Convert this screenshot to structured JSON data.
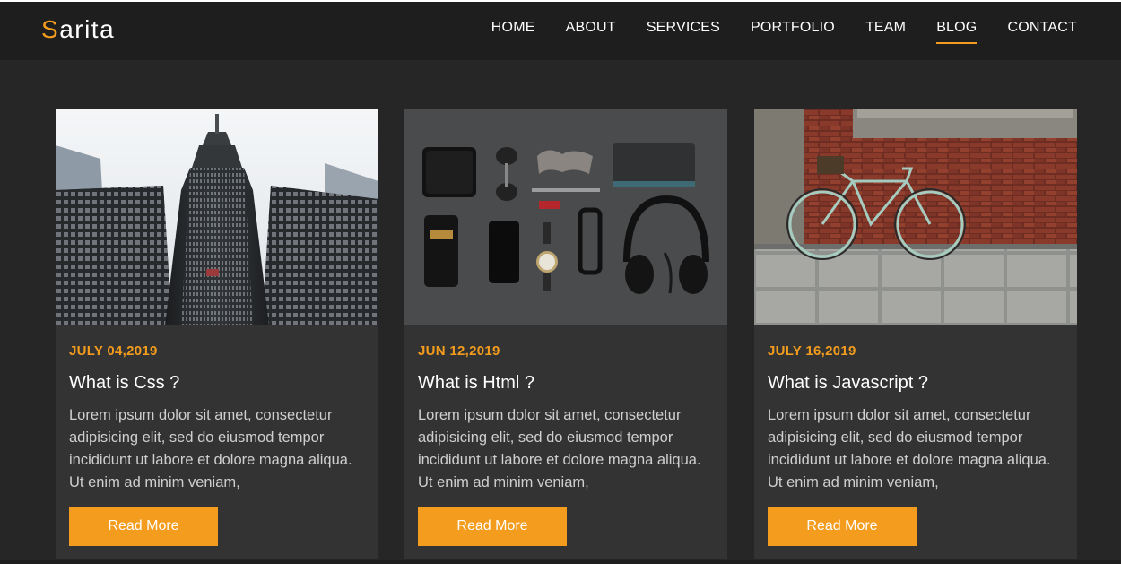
{
  "brand": {
    "first_letter": "S",
    "rest": "arita"
  },
  "nav": {
    "items": [
      {
        "label": "HOME"
      },
      {
        "label": "ABOUT"
      },
      {
        "label": "SERVICES"
      },
      {
        "label": "PORTFOLIO"
      },
      {
        "label": "TEAM"
      },
      {
        "label": "BLOG"
      },
      {
        "label": "CONTACT"
      }
    ],
    "active": "BLOG"
  },
  "posts": [
    {
      "date": "JULY 04,2019",
      "title": "What is Css ?",
      "excerpt": "Lorem ipsum dolor sit amet, consectetur adipisicing elit, sed do eiusmod tempor incididunt ut labore et dolore magna aliqua. Ut enim ad minim veniam,",
      "button": "Read More",
      "image": "skyscraper-photo"
    },
    {
      "date": "JUN 12,2019",
      "title": "What is Html ?",
      "excerpt": "Lorem ipsum dolor sit amet, consectetur adipisicing elit, sed do eiusmod tempor incididunt ut labore et dolore magna aliqua. Ut enim ad minim veniam,",
      "button": "Read More",
      "image": "flatlay-accessories-photo"
    },
    {
      "date": "JULY 16,2019",
      "title": "What is Javascript ?",
      "excerpt": "Lorem ipsum dolor sit amet, consectetur adipisicing elit, sed do eiusmod tempor incididunt ut labore et dolore magna aliqua. Ut enim ad minim veniam,",
      "button": "Read More",
      "image": "bicycle-brick-wall-photo"
    }
  ],
  "colors": {
    "accent": "#f39c1d",
    "background": "#262626",
    "navbar": "#1e1e1e",
    "card": "#333333"
  }
}
